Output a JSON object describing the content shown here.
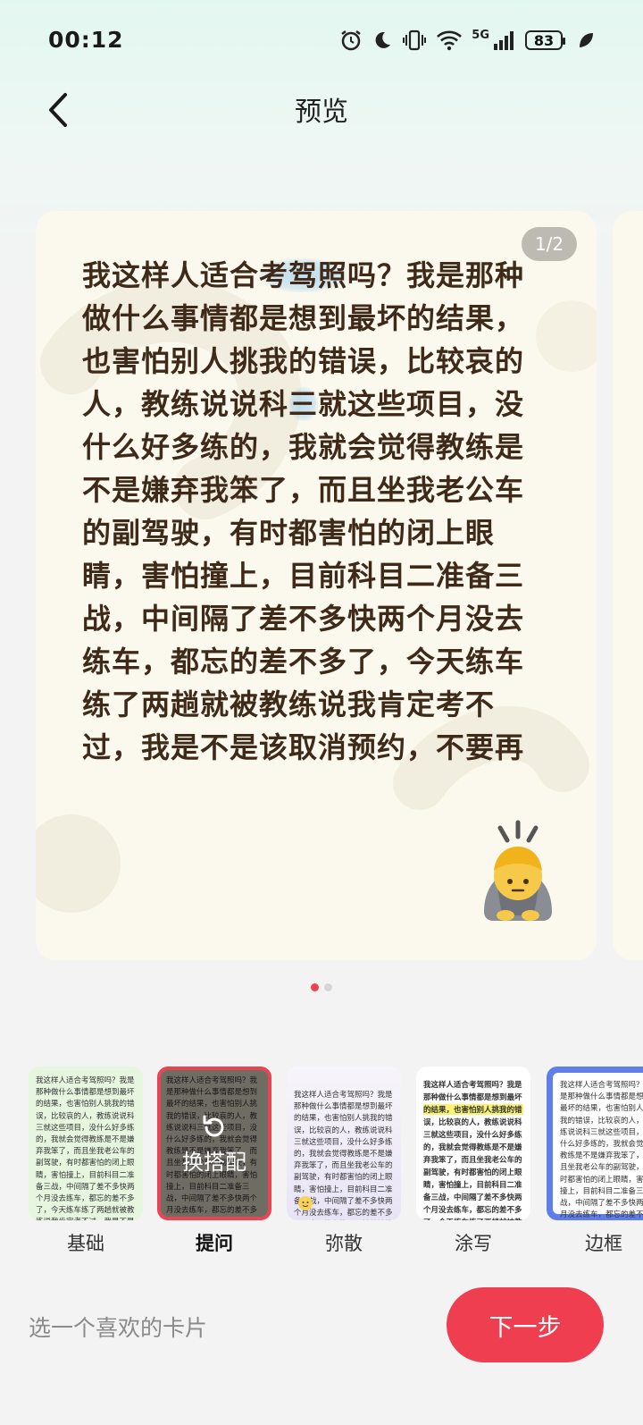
{
  "status_bar": {
    "time": "00:12",
    "network": "5G",
    "battery": "83"
  },
  "header": {
    "title": "预览"
  },
  "card": {
    "page_indicator": "1/2",
    "text_before_h1": "我这样人适合",
    "highlight_1": "考驾照",
    "text_mid": "吗？我是那种做什么事情都是想到最坏的结果，也害怕别人挑我的错误，比较哀的人，教练说说科",
    "highlight_2": "三",
    "text_after": "就这些项目，没什么好多练的，我就会觉得教练是不是嫌弃我笨了，而且坐我老公车的副驾驶，有时都害怕的闭上眼睛，害怕撞上，目前科目二准备三战，中间隔了差不多快两个月没去练车，都忘的差不多了，今天练车练了两趟就被教练说我肯定考不过，我是不是该取消预约，不要再",
    "emoji": "bowing-person-icon"
  },
  "pager": {
    "count": 2,
    "active": 0
  },
  "styles": {
    "preview_text": "我这样人适合考驾照吗？我是那种做什么事情都是想到最坏的结果，也害怕别人挑我的错误，比较哀的人，教练说说科三就这些项目，没什么好多练的，我就会觉得教练是不是嫌弃我笨了，而且坐我老公车的副驾驶，有时都害怕的闭上眼睛，害怕撞上，目前科目二准备三战，中间隔了差不多快两个月没去练车，都忘的差不多了，今天练车练了两趟就被教练说我肯定考不过，我是不是该取消预约，不要再",
    "overlay_label": "换搭配",
    "items": [
      {
        "label": "基础",
        "bg": "#e6f6df"
      },
      {
        "label": "提问",
        "bg": "#f6f0de"
      },
      {
        "label": "弥散",
        "bg": "#eeebf8"
      },
      {
        "label": "涂写",
        "bg": "#ffffff"
      },
      {
        "label": "边框",
        "bg": "#5f7ee8"
      }
    ],
    "selected": 1
  },
  "footer": {
    "hint": "选一个喜欢的卡片",
    "next_label": "下一步"
  },
  "colors": {
    "accent": "#ee3e4f",
    "card_text": "#3f2a19",
    "card_bg": "#fbf8ed"
  }
}
